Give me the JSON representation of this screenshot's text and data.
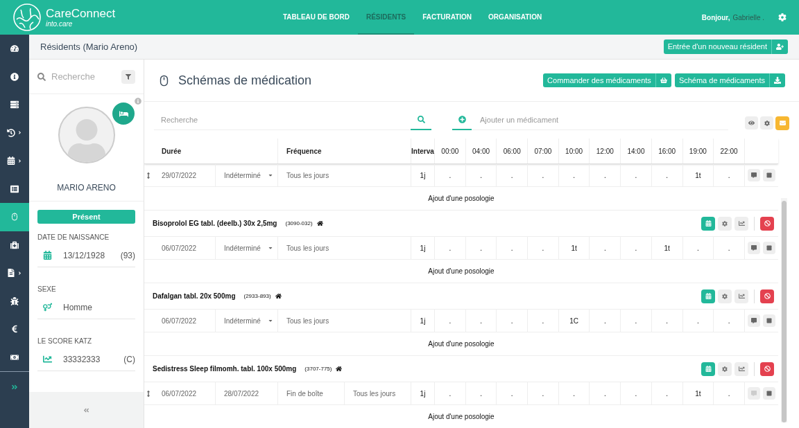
{
  "header": {
    "brand": "CareConnect",
    "brand_sub": "into.care",
    "tabs": [
      {
        "label": "TABLEAU DE BORD",
        "selected": false
      },
      {
        "label": "RÉSIDENTS",
        "selected": true
      },
      {
        "label": "FACTURATION",
        "selected": false
      },
      {
        "label": "ORGANISATION",
        "selected": false
      }
    ],
    "greeting": "Bonjour,",
    "user": "Gabrielle ."
  },
  "nav": [
    {
      "selected": false,
      "submenu": false
    },
    {
      "selected": false,
      "submenu": false
    },
    {
      "selected": false,
      "submenu": false
    },
    {
      "selected": false,
      "submenu": true
    },
    {
      "selected": false,
      "submenu": true
    },
    {
      "selected": false,
      "submenu": false
    },
    {
      "selected": true,
      "submenu": false
    },
    {
      "selected": false,
      "submenu": false
    },
    {
      "selected": false,
      "submenu": true
    },
    {
      "selected": false,
      "submenu": false
    },
    {
      "selected": false,
      "submenu": false
    },
    {
      "selected": false,
      "submenu": false
    }
  ],
  "breadcrumb": "Résidents (Mario Areno)",
  "new_resident_button": "Entrée d'un nouveau résident",
  "patient": {
    "search_placeholder": "Recherche",
    "name": "MARIO ARENO",
    "status": "Présent",
    "fields": [
      {
        "label": "DATE DE NAISSANCE",
        "value": "13/12/1928",
        "extra": "(93)"
      },
      {
        "label": "SEXE",
        "value": "Homme"
      },
      {
        "label": "LE SCORE KATZ",
        "value": "33332333",
        "extra": "(C)"
      }
    ]
  },
  "main": {
    "title": "Schémas de médication",
    "buttons": [
      "Commander des médicaments",
      "Schéma de médicaments"
    ],
    "search_placeholder": "Recherche",
    "add_placeholder": "Ajouter un médicament",
    "columns": [
      "Durée",
      "Fréquence",
      "Interva"
    ],
    "times": [
      "00:00",
      "04:00",
      "06:00",
      "07:00",
      "10:00",
      "12:00",
      "14:00",
      "16:00",
      "19:00",
      "22:00"
    ],
    "medications": [
      {
        "rows": [
          {
            "draggable": true,
            "start": "29/07/2022",
            "cells": [
              {
                "kind": "dropdown",
                "text": "Indéterminé"
              },
              {
                "kind": "text",
                "text": "Tous les jours"
              }
            ],
            "interval": "1j",
            "doses": [
              ".",
              ".",
              ".",
              ".",
              ".",
              ".",
              ".",
              ".",
              "1t",
              "."
            ],
            "comment": true
          }
        ],
        "add_label": "Ajout d'une posologie"
      },
      {
        "name": "Bisoprolol EG tabl. (deelb.) 30x 2,5mg",
        "code": "(3090-032)",
        "rows": [
          {
            "draggable": false,
            "start": "06/07/2022",
            "cells": [
              {
                "kind": "dropdown",
                "text": "Indéterminé"
              },
              {
                "kind": "text",
                "text": "Tous les jours"
              }
            ],
            "interval": "1j",
            "doses": [
              ".",
              ".",
              ".",
              ".",
              "1t",
              ".",
              ".",
              "1t",
              ".",
              "."
            ],
            "comment": true
          }
        ],
        "add_label": "Ajout d'une posologie"
      },
      {
        "name": "Dafalgan tabl. 20x 500mg",
        "code": "(2933-893)",
        "rows": [
          {
            "draggable": false,
            "start": "06/07/2022",
            "cells": [
              {
                "kind": "dropdown",
                "text": "Indéterminé"
              },
              {
                "kind": "text",
                "text": "Tous les jours"
              }
            ],
            "interval": "1j",
            "doses": [
              ".",
              ".",
              ".",
              ".",
              "1C",
              ".",
              ".",
              ".",
              ".",
              "."
            ],
            "comment": true
          }
        ],
        "add_label": "Ajout d'une posologie"
      },
      {
        "name": "Sedistress Sleep filmomh. tabl. 100x 500mg",
        "code": "(3707-775)",
        "rows": [
          {
            "draggable": true,
            "start": "06/07/2022",
            "cells": [
              {
                "kind": "text",
                "text": "28/07/2022"
              },
              {
                "kind": "text",
                "text": "Fin de boîte"
              },
              {
                "kind": "text",
                "text": "Tous les jours"
              }
            ],
            "interval": "1j",
            "doses": [
              ".",
              ".",
              ".",
              ".",
              ".",
              ".",
              ".",
              ".",
              "1t",
              "."
            ],
            "comment": false
          }
        ],
        "add_label": "Ajout d'une posologie"
      }
    ]
  }
}
